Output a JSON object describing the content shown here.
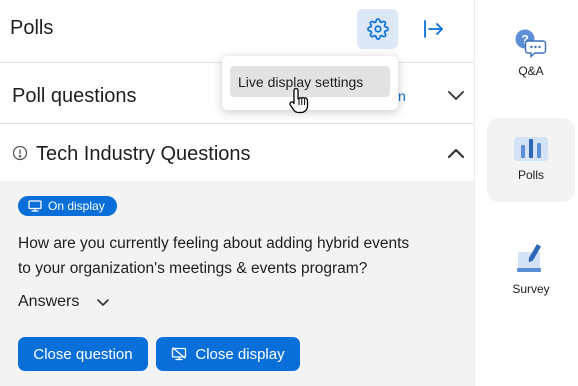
{
  "header": {
    "title": "Polls"
  },
  "poll_questions": {
    "label": "Poll questions",
    "partial_link": "n"
  },
  "group": {
    "title": "Tech Industry Questions"
  },
  "active_poll": {
    "badge": "On display",
    "question_line1": "How are you currently feeling about adding hybrid events",
    "question_line2": "to your organization's meetings & events program?",
    "answers_label": "Answers",
    "close_question_label": "Close question",
    "close_display_label": "Close display"
  },
  "popover": {
    "item": "Live display settings"
  },
  "sidebar": {
    "items": [
      {
        "label": "Q&A",
        "icon": "qa-icon",
        "active": false
      },
      {
        "label": "Polls",
        "icon": "polls-icon",
        "active": true
      },
      {
        "label": "Survey",
        "icon": "survey-icon",
        "active": false
      }
    ]
  },
  "colors": {
    "accent": "#0a6fd8",
    "panel_bg": "#f3f3f3",
    "gear_bg": "#dce8f6"
  }
}
